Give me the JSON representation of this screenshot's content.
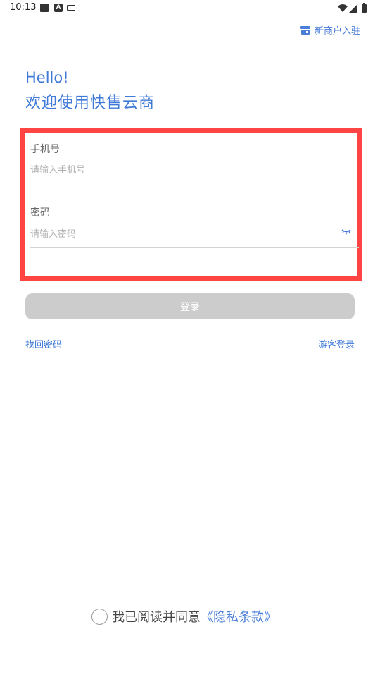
{
  "status_bar": {
    "time": "10:13",
    "icons": [
      "image-icon",
      "a-notification-icon",
      "keyboard-icon",
      "wifi-icon",
      "signal-icon",
      "battery-icon"
    ]
  },
  "header": {
    "merchant_link": "新商户入驻",
    "merchant_icon": "store-icon"
  },
  "greeting": {
    "hello": "Hello!",
    "welcome": "欢迎使用快售云商"
  },
  "form": {
    "phone_label": "手机号",
    "phone_placeholder": "请输入手机号",
    "phone_value": "",
    "password_label": "密码",
    "password_placeholder": "请输入密码",
    "password_value": "",
    "password_toggle_icon": "eye-closed-icon",
    "highlight_color": "#ff4444"
  },
  "actions": {
    "login_label": "登录",
    "forgot_password": "找回密码",
    "guest_login": "游客登录"
  },
  "agreement": {
    "checked": false,
    "text": "我已阅读并同意",
    "link": "《隐私条款》"
  },
  "colors": {
    "accent": "#3f7ad8",
    "button_disabled": "#cccccc",
    "highlight": "#ff4444"
  }
}
